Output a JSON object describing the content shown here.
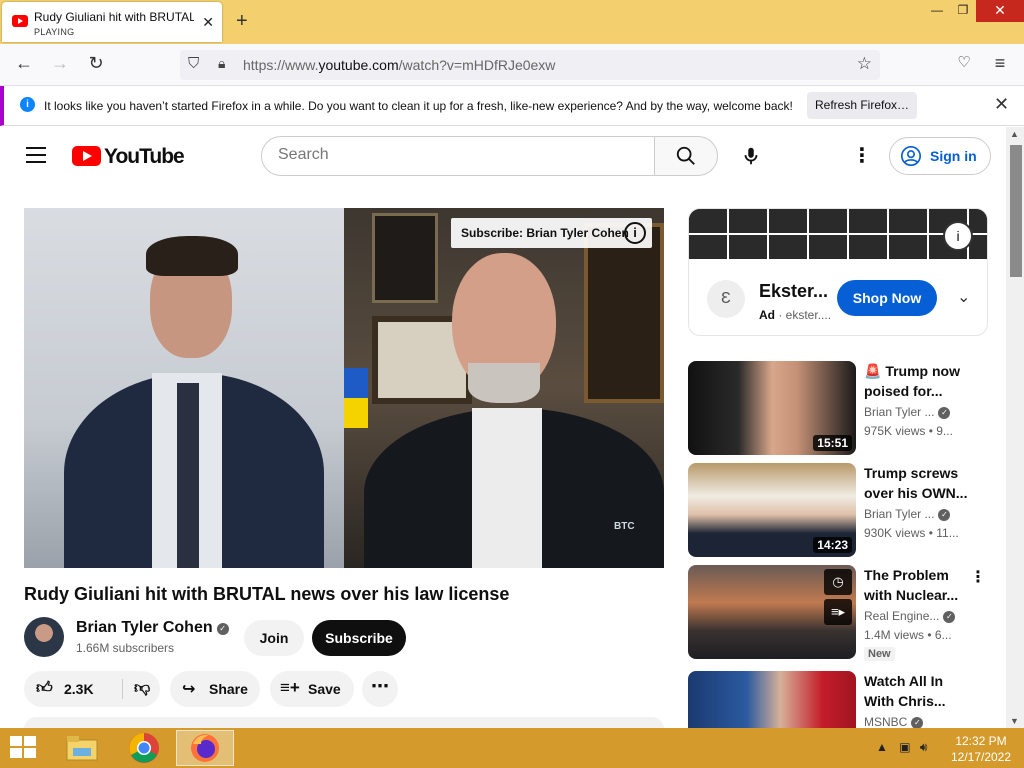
{
  "browser": {
    "tab_title": "Rudy Giuliani hit with BRUTAL news over his law license",
    "tab_status": "PLAYING",
    "url_prefix": "https://www.",
    "url_domain": "youtube.com",
    "url_path": "/watch?v=mHDfRJe0exw",
    "notification": "It looks like you haven’t started Firefox in a while. Do you want to clean it up for a fresh, like-new experience? And by the way, welcome back!",
    "refresh_label": "Refresh Firefox…"
  },
  "youtube": {
    "logo_text": "YouTube",
    "search_placeholder": "Search",
    "signin_label": "Sign in"
  },
  "video": {
    "title": "Rudy Giuliani hit with BRUTAL news over his law license",
    "overlay_subscribe": "Subscribe: Brian Tyler Cohen",
    "channel_name": "Brian Tyler Cohen",
    "subscribers": "1.66M subscribers",
    "join_label": "Join",
    "subscribe_label": "Subscribe",
    "likes": "2.3K",
    "share_label": "Share",
    "save_label": "Save",
    "watermark": "BTC"
  },
  "ad": {
    "name": "Ekster...",
    "label": "Ad",
    "domain": "ekster....",
    "cta": "Shop Now"
  },
  "recommendations": [
    {
      "title": "🚨 Trump now poised for...",
      "channel": "Brian Tyler ...",
      "views": "975K views",
      "age": "9...",
      "duration": "15:51"
    },
    {
      "title": "Trump screws over his OWN...",
      "channel": "Brian Tyler ...",
      "views": "930K views",
      "age": "11...",
      "duration": "14:23"
    },
    {
      "title": "The Problem with Nuclear...",
      "channel": "Real Engine...",
      "views": "1.4M views",
      "age": "6...",
      "badge": "New"
    },
    {
      "title": "Watch All In With Chris...",
      "channel": "MSNBC",
      "views": "",
      "age": ""
    }
  ],
  "taskbar": {
    "time": "12:32 PM",
    "date": "12/17/2022"
  },
  "colors": {
    "titlebar": "#f3cf6d",
    "taskbar": "#d49b2c",
    "yt_red": "#ff0000",
    "link_blue": "#065fd4"
  }
}
